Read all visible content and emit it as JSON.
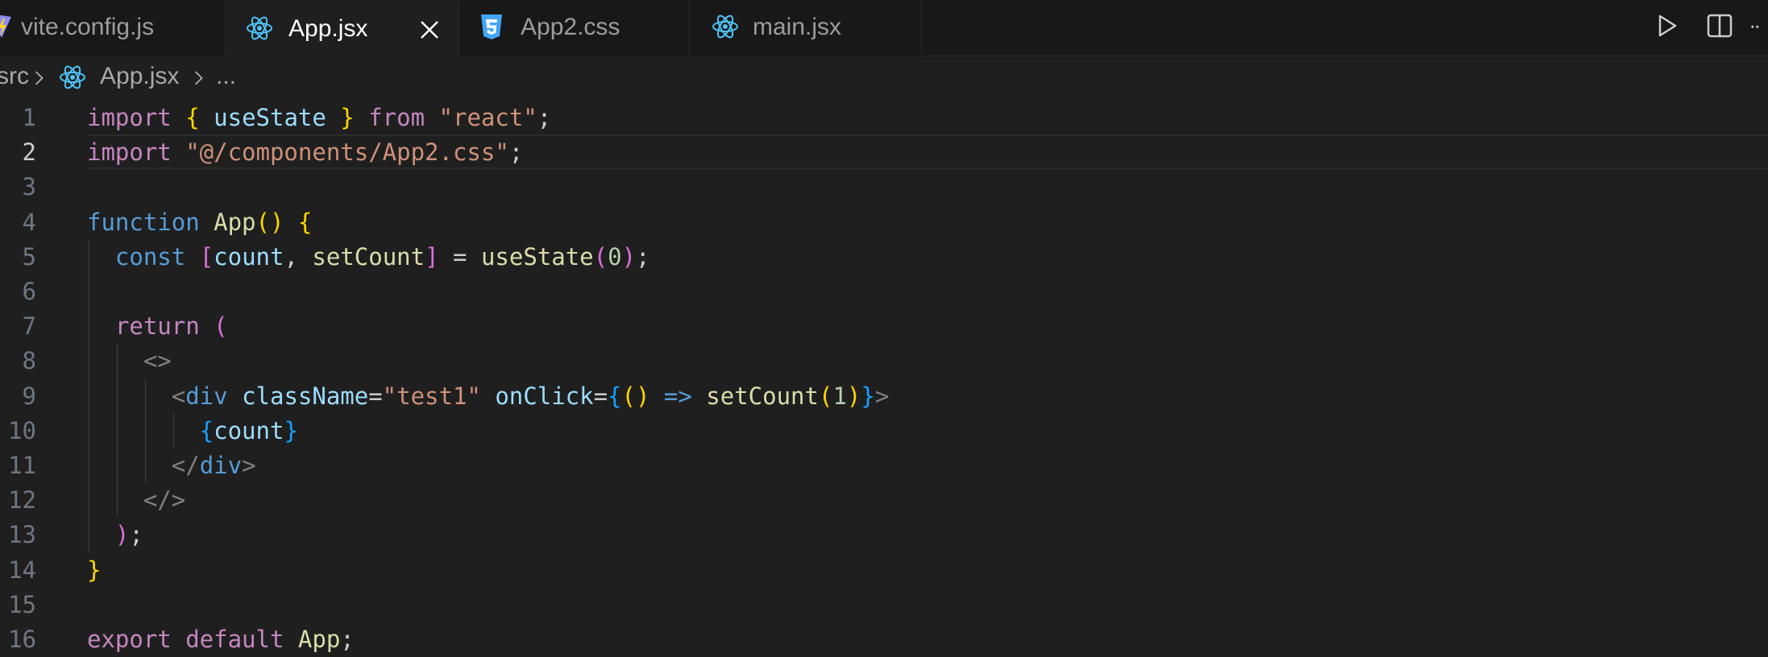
{
  "tabs": [
    {
      "label": "vite.config.js",
      "icon": "vite-icon"
    },
    {
      "label": "App.jsx",
      "icon": "react-icon",
      "active": true
    },
    {
      "label": "App2.css",
      "icon": "css3-icon"
    },
    {
      "label": "main.jsx",
      "icon": "react-icon"
    }
  ],
  "actions": {
    "run": "run-icon",
    "split": "split-editor-icon",
    "more": "more-icon"
  },
  "breadcrumb": {
    "folder": "src",
    "file": "App.jsx",
    "symbol": "..."
  },
  "editor": {
    "current_line": 2,
    "line_numbers": [
      "1",
      "2",
      "3",
      "4",
      "5",
      "6",
      "7",
      "8",
      "9",
      "10",
      "11",
      "12",
      "13",
      "14",
      "15",
      "16"
    ],
    "lines": [
      [
        {
          "t": "import ",
          "c": "kw"
        },
        {
          "t": "{",
          "c": "b1"
        },
        {
          "t": " useState ",
          "c": "var"
        },
        {
          "t": "}",
          "c": "b1"
        },
        {
          "t": " from ",
          "c": "kw"
        },
        {
          "t": "\"react\"",
          "c": "st"
        },
        {
          "t": ";",
          "c": "pl"
        }
      ],
      [
        {
          "t": "import ",
          "c": "kw"
        },
        {
          "t": "\"@/components/App2.css\"",
          "c": "st"
        },
        {
          "t": ";",
          "c": "pl"
        }
      ],
      [],
      [
        {
          "t": "function ",
          "c": "dec"
        },
        {
          "t": "App",
          "c": "fn"
        },
        {
          "t": "()",
          "c": "b1"
        },
        {
          "t": " ",
          "c": "pl"
        },
        {
          "t": "{",
          "c": "b1"
        }
      ],
      [
        {
          "t": "  const ",
          "c": "dec"
        },
        {
          "t": "[",
          "c": "b2"
        },
        {
          "t": "count",
          "c": "var"
        },
        {
          "t": ", ",
          "c": "pl"
        },
        {
          "t": "setCount",
          "c": "fn"
        },
        {
          "t": "]",
          "c": "b2"
        },
        {
          "t": " = ",
          "c": "pl"
        },
        {
          "t": "useState",
          "c": "fn"
        },
        {
          "t": "(",
          "c": "b2"
        },
        {
          "t": "0",
          "c": "num"
        },
        {
          "t": ")",
          "c": "b2"
        },
        {
          "t": ";",
          "c": "pl"
        }
      ],
      [],
      [
        {
          "t": "  return ",
          "c": "kw"
        },
        {
          "t": "(",
          "c": "b2"
        }
      ],
      [
        {
          "t": "    <>",
          "c": "ang"
        }
      ],
      [
        {
          "t": "      <",
          "c": "ang"
        },
        {
          "t": "div ",
          "c": "tag"
        },
        {
          "t": "className",
          "c": "var"
        },
        {
          "t": "=",
          "c": "pl"
        },
        {
          "t": "\"test1\"",
          "c": "st"
        },
        {
          "t": " onClick",
          "c": "var"
        },
        {
          "t": "=",
          "c": "pl"
        },
        {
          "t": "{",
          "c": "b3"
        },
        {
          "t": "()",
          "c": "b1"
        },
        {
          "t": " => ",
          "c": "dec"
        },
        {
          "t": "setCount",
          "c": "fn"
        },
        {
          "t": "(",
          "c": "b1"
        },
        {
          "t": "1",
          "c": "num"
        },
        {
          "t": ")",
          "c": "b1"
        },
        {
          "t": "}",
          "c": "b3"
        },
        {
          "t": ">",
          "c": "ang"
        }
      ],
      [
        {
          "t": "        {",
          "c": "b3"
        },
        {
          "t": "count",
          "c": "var"
        },
        {
          "t": "}",
          "c": "b3"
        }
      ],
      [
        {
          "t": "      </",
          "c": "ang"
        },
        {
          "t": "div",
          "c": "tag"
        },
        {
          "t": ">",
          "c": "ang"
        }
      ],
      [
        {
          "t": "    </>",
          "c": "ang"
        }
      ],
      [
        {
          "t": "  ",
          "c": "pl"
        },
        {
          "t": ")",
          "c": "b2"
        },
        {
          "t": ";",
          "c": "pl"
        }
      ],
      [
        {
          "t": "}",
          "c": "b1"
        }
      ],
      [],
      [
        {
          "t": "export ",
          "c": "kw"
        },
        {
          "t": "default ",
          "c": "kw"
        },
        {
          "t": "App",
          "c": "fn"
        },
        {
          "t": ";",
          "c": "pl"
        }
      ]
    ]
  },
  "colors": {
    "background": "#1f1f1f",
    "keyword": "#c586c0",
    "string": "#ce9178",
    "function": "#dcdcaa",
    "variable": "#9cdcfe",
    "react_icon": "#4fc3f7",
    "css_icon": "#42a5f5"
  }
}
